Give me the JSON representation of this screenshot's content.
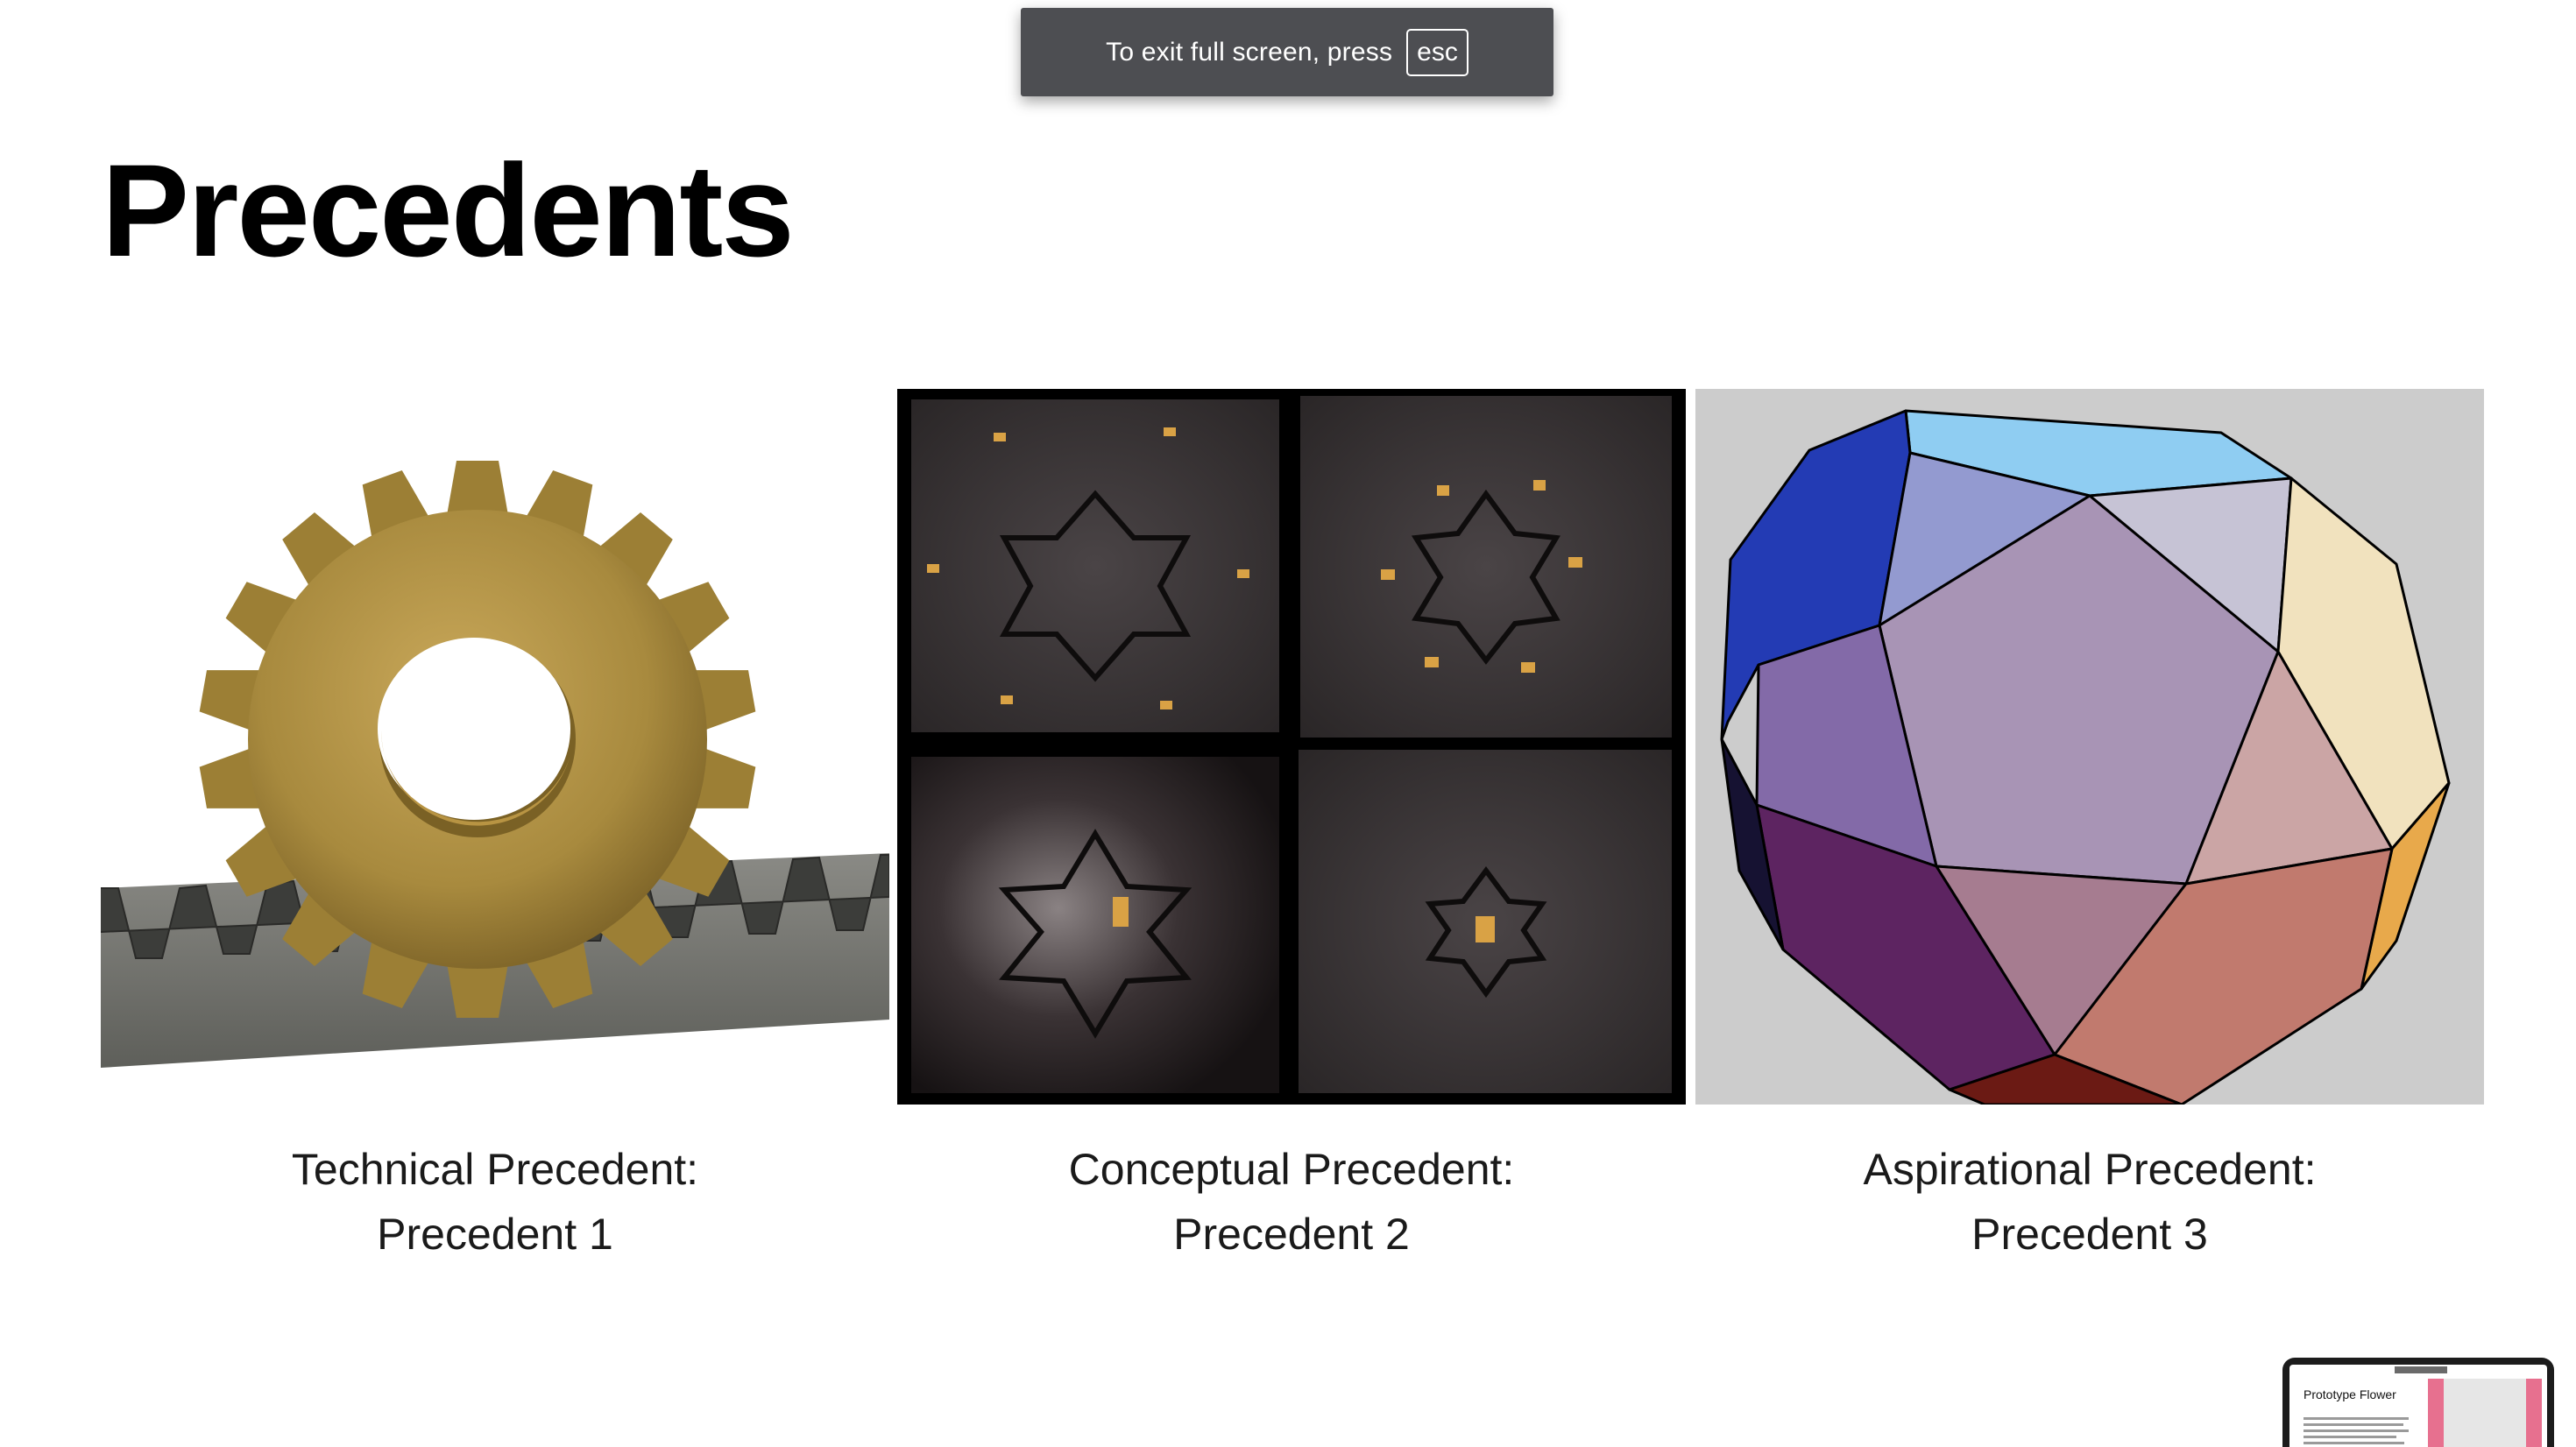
{
  "fullscreen_notice": {
    "text": "To exit full screen, press",
    "key": "esc"
  },
  "slide": {
    "title": "Precedents"
  },
  "precedents": [
    {
      "image": "gear-and-rack-image",
      "caption_line1": "Technical Precedent:",
      "caption_line2": "Precedent 1"
    },
    {
      "image": "kinetic-star-sculpture-image",
      "caption_line1": "Conceptual Precedent:",
      "caption_line2": "Precedent 2"
    },
    {
      "image": "polyhedron-image",
      "caption_line1": "Aspirational Precedent:",
      "caption_line2": "Precedent 3"
    }
  ],
  "preview_window": {
    "title": "Prototype Flower"
  }
}
